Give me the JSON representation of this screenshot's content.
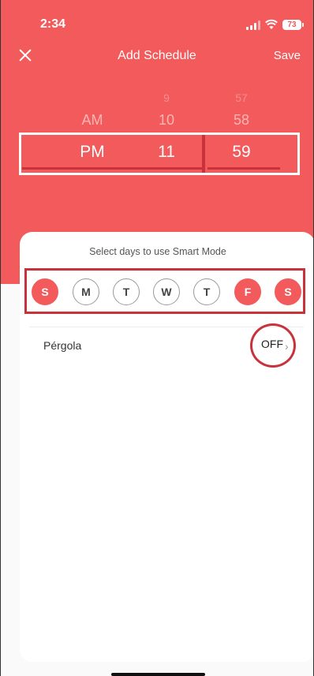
{
  "status_bar": {
    "time": "2:34",
    "battery": "73"
  },
  "nav": {
    "title": "Add Schedule",
    "save_label": "Save"
  },
  "picker": {
    "ampm": {
      "above": "AM",
      "selected": "PM"
    },
    "hour": {
      "above2": "9",
      "above1": "10",
      "selected": "11"
    },
    "minute": {
      "above2": "57",
      "above1": "58",
      "selected": "59"
    }
  },
  "sheet": {
    "label": "Select days to use Smart Mode",
    "days": [
      {
        "letter": "S",
        "selected": true
      },
      {
        "letter": "M",
        "selected": false
      },
      {
        "letter": "T",
        "selected": false
      },
      {
        "letter": "W",
        "selected": false
      },
      {
        "letter": "T",
        "selected": false
      },
      {
        "letter": "F",
        "selected": true
      },
      {
        "letter": "S",
        "selected": true
      }
    ],
    "device_name": "Pérgola",
    "device_state": "OFF"
  },
  "colors": {
    "accent": "#f25a5c",
    "annotation": "#c8323b"
  }
}
